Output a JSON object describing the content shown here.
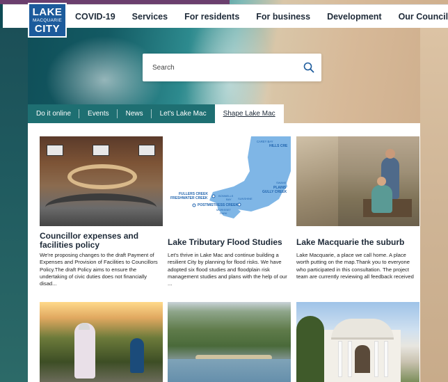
{
  "logo": {
    "line1": "LAKE",
    "line2": "MACQUARIE",
    "line3": "CITY"
  },
  "nav": [
    "COVID-19",
    "Services",
    "For residents",
    "For business",
    "Development",
    "Our Council"
  ],
  "search": {
    "placeholder": "Search",
    "icon": "search-icon"
  },
  "tabs": [
    "Do it online",
    "Events",
    "News",
    "Let's Lake Mac",
    "Shape Lake Mac"
  ],
  "active_tab": "Shape Lake Mac",
  "cards": [
    {
      "title": "Councillor expenses and facilities policy",
      "description": "We're proposing changes to the draft Payment of Expenses and Provision of Facilities to Councillors Policy.The draft Policy aims to ensure the undertaking of civic duties does not financially disad...",
      "image": "council-chamber"
    },
    {
      "title": "Lake Tributary Flood Studies",
      "description": "Let's thrive in Lake Mac and continue building a resilient City by planning for flood risks. We have adopted six flood studies and floodplain risk management studies and plans with the help of our ...",
      "image": "tributary-map"
    },
    {
      "title": "Lake Macquarie the suburb",
      "description": "Lake Macquarie, a place we call home. A place worth putting on the map.Thank you to everyone who participated in this consultation. The project team are currently reviewing all feedback received",
      "image": "couple-on-porch"
    },
    {
      "image": "cyclists"
    },
    {
      "image": "aerial-lake"
    },
    {
      "image": "white-house"
    }
  ],
  "map_labels": {
    "carey_bay": "CAREY BAY",
    "hills_cre": "HILLS CRE",
    "fullers": "FULLERS CREEK",
    "freshwater": "FRESHWATER CREEK",
    "bonnells": "BONNELLS",
    "bay": "BAY",
    "sunshine": "SUNSHINE",
    "postmistress": "POSTMISTRESS CREEK",
    "morisset": "MORISSET",
    "park": "PARK",
    "swans": "SWANS",
    "plains": "PLAINS",
    "gully": "GULLY CREEK"
  },
  "colors": {
    "nav_text": "#1e2a38",
    "tab_bg": "#1e6f72",
    "logo_bg": "#1c5b9c",
    "purple": "#6b3f6e",
    "map_water": "#7fb6e6",
    "map_label": "#1f63ad"
  }
}
